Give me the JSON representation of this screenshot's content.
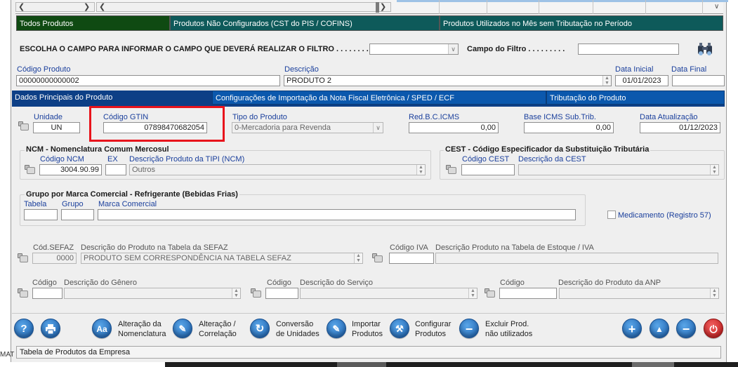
{
  "filter_tabs": [
    {
      "label": "Todos Produtos"
    },
    {
      "label": "Produtos Não Configurados (CST do PIS / COFINS)"
    },
    {
      "label": "Produtos Utilizados no Mês sem Tributação no Período"
    }
  ],
  "filter": {
    "prompt": "ESCOLHA O CAMPO PARA INFORMAR O CAMPO QUE DEVERÁ REALIZAR O FILTRO . . . . . . . . . :",
    "field_value": "",
    "field_label": "Campo do Filtro . . . . . . . . .",
    "field_input": ""
  },
  "product": {
    "codigo_label": "Código Produto",
    "codigo_value": "00000000000002",
    "descricao_label": "Descrição",
    "descricao_value": "PRODUTO 2",
    "data_inicial_label": "Data Inicial",
    "data_inicial_value": "01/01/2023",
    "data_final_label": "Data Final",
    "data_final_value": ""
  },
  "section_tabs": [
    {
      "label": "Dados Principais do Produto"
    },
    {
      "label": "Configurações de Importação da Nota Fiscal Eletrônica / SPED / ECF"
    },
    {
      "label": "Tributação do Produto"
    }
  ],
  "main": {
    "unidade_label": "Unidade",
    "unidade_value": "UN",
    "gtin_label": "Código GTIN",
    "gtin_value": "07898470682054",
    "tipo_label": "Tipo do Produto",
    "tipo_value": "0-Mercadoria para Revenda",
    "redbc_label": "Red.B.C.ICMS",
    "redbc_value": "0,00",
    "baseicms_label": "Base ICMS Sub.Trib.",
    "baseicms_value": "0,00",
    "data_atual_label": "Data Atualização",
    "data_atual_value": "01/12/2023"
  },
  "ncm": {
    "title": "NCM - Nomenclatura Comum Mercosul",
    "codigo_label": "Código NCM",
    "codigo_value": "3004.90.99",
    "ex_label": "EX",
    "ex_value": "",
    "desc_label": "Descrição Produto da TIPI (NCM)",
    "desc_value": "Outros"
  },
  "cest": {
    "title": "CEST - Código Especificador da Substituição Tributária",
    "codigo_label": "Código CEST",
    "codigo_value": "",
    "desc_label": "Descrição da CEST",
    "desc_value": ""
  },
  "marca": {
    "title": "Grupo por Marca Comercial - Refrigerante (Bebidas Frias)",
    "tabela_label": "Tabela",
    "grupo_label": "Grupo",
    "marca_label": "Marca Comercial"
  },
  "medicamento_label": "Medicamento  (Registro  57)",
  "sefaz": {
    "codigo_label": "Cód.SEFAZ",
    "codigo_value": "0000",
    "desc_label": "Descrição do Produto na Tabela da SEFAZ",
    "desc_value": "PRODUTO SEM CORRESPONDÊNCIA NA TABELA SEFAZ"
  },
  "iva": {
    "codigo_label": "Código IVA",
    "desc_label": "Descrição Produto na Tabela de Estoque / IVA"
  },
  "genero": {
    "codigo_label": "Código",
    "desc_label": "Descrição do Gênero"
  },
  "servico": {
    "codigo_label": "Código",
    "desc_label": "Descrição do Serviço"
  },
  "anp": {
    "codigo_label": "Código",
    "desc_label": "Descrição do Produto da ANP"
  },
  "toolbar": {
    "alteracao_nom_1": "Alteração da",
    "alteracao_nom_2": "Nomenclatura",
    "alteracao_cor_1": "Alteração /",
    "alteracao_cor_2": "Correlação",
    "conversao_1": "Conversão",
    "conversao_2": "de Unidades",
    "importar_1": "Importar",
    "importar_2": "Produtos",
    "configurar_1": "Configurar",
    "configurar_2": "Produtos",
    "excluir_1": "Excluir Prod.",
    "excluir_2": "não utilizados",
    "aa_glyph": "Aa"
  },
  "status_text": "Tabela de Produtos da Empresa",
  "corner_text": "MAT",
  "colors": {
    "accent_blue": "#0d3f86",
    "tab_green": "#0f4a12",
    "tab_teal": "#0e5a5a",
    "highlight_red": "#e8141c"
  }
}
